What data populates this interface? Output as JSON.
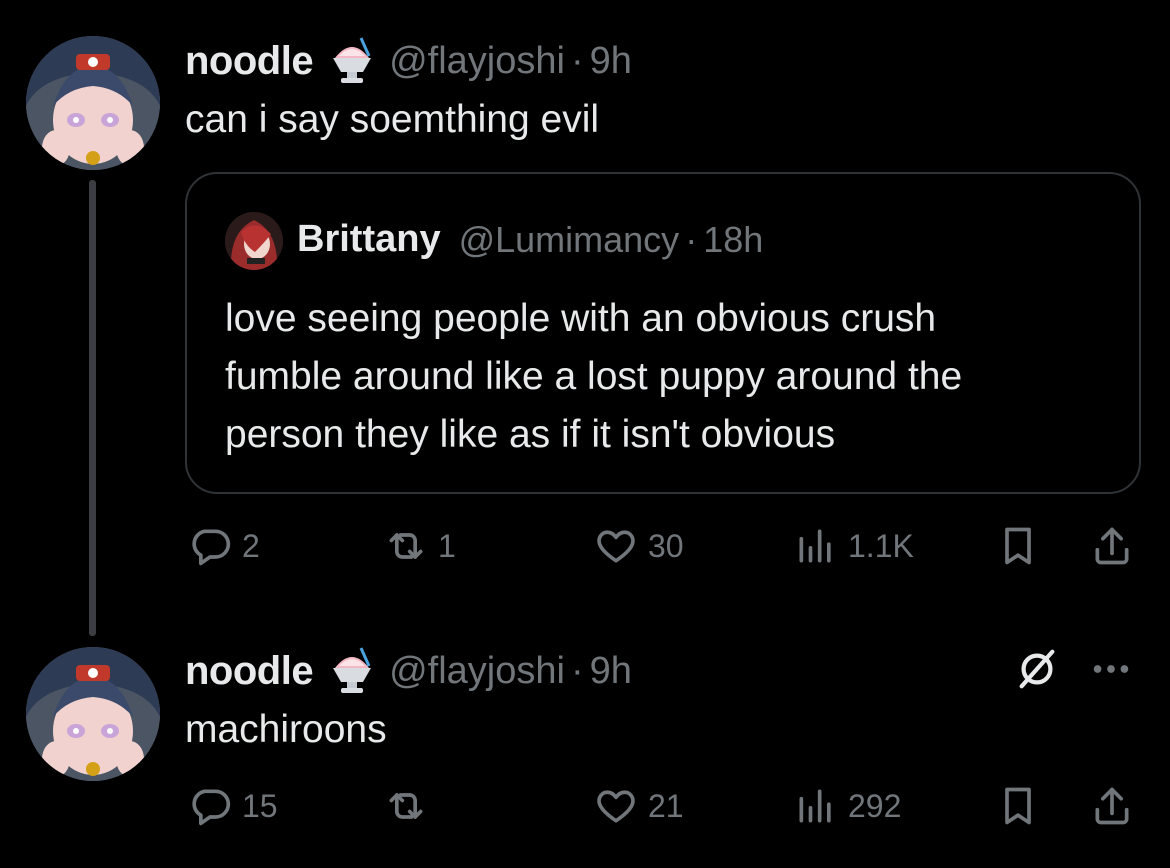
{
  "tweet1": {
    "name": "noodle",
    "handle": "@flayjoshi",
    "separator": "·",
    "time": "9h",
    "text": "can i say soemthing evil",
    "quote": {
      "name": "Brittany",
      "handle": "@Lumimancy",
      "separator": "·",
      "time": "18h",
      "lines": [
        "love seeing people with an obvious crush",
        "fumble around like a lost puppy around the",
        "person they like as if it isn't obvious"
      ]
    },
    "actions": {
      "replies": "2",
      "reposts": "1",
      "likes": "30",
      "views": "1.1K"
    }
  },
  "tweet2": {
    "name": "noodle",
    "handle": "@flayjoshi",
    "separator": "·",
    "time": "9h",
    "text": "machiroons",
    "actions": {
      "replies": "15",
      "reposts": "",
      "likes": "21",
      "views": "292"
    }
  },
  "icons": {
    "reply": "reply-icon",
    "repost": "repost-icon",
    "like": "heart-icon",
    "views": "views-icon",
    "bookmark": "bookmark-icon",
    "share": "share-icon",
    "more": "more-icon",
    "grok": "grok-icon",
    "emoji": "shaved-ice-emoji"
  },
  "colors": {
    "background": "#000000",
    "text": "#e7e9ea",
    "secondary": "#71767b",
    "border": "#2f3336"
  }
}
